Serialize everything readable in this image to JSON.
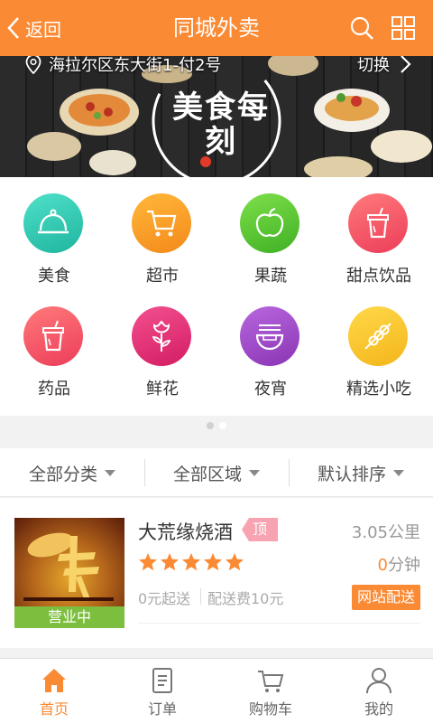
{
  "header": {
    "back_label": "返回",
    "title": "同城外卖"
  },
  "banner": {
    "address": "海拉尔区东大街1-付2号",
    "switch_label": "切换",
    "slogan": "美食每刻"
  },
  "categories": [
    {
      "label": "美食",
      "icon": "cloche-icon",
      "color": "#36c9b4"
    },
    {
      "label": "超市",
      "icon": "shopping-cart-icon",
      "color": "#f7a022"
    },
    {
      "label": "果蔬",
      "icon": "apple-icon",
      "color": "#5cc72e"
    },
    {
      "label": "甜点饮品",
      "icon": "drink-cup-icon",
      "color": "#f25a6a"
    },
    {
      "label": "药品",
      "icon": "medicine-icon",
      "color": "#f25a6a"
    },
    {
      "label": "鲜花",
      "icon": "rose-icon",
      "color": "#e7337a"
    },
    {
      "label": "夜宵",
      "icon": "noodle-bowl-icon",
      "color": "#9d48c2"
    },
    {
      "label": "精选小吃",
      "icon": "skewer-icon",
      "color": "#f7c82a"
    }
  ],
  "filters": [
    {
      "label": "全部分类"
    },
    {
      "label": "全部区域"
    },
    {
      "label": "默认排序"
    }
  ],
  "shop": {
    "name": "大荒缘烧酒",
    "tag": "顶",
    "distance": "3.05公里",
    "rating": 5,
    "time_value": "0",
    "time_unit": "分钟",
    "min_order": "0元起送",
    "delivery_fee": "配送费10元",
    "delivery_type": "网站配送",
    "status": "营业中"
  },
  "tabs": [
    {
      "label": "首页",
      "icon": "home-icon",
      "active": true
    },
    {
      "label": "订单",
      "icon": "order-icon",
      "active": false
    },
    {
      "label": "购物车",
      "icon": "cart-icon",
      "active": false
    },
    {
      "label": "我的",
      "icon": "user-icon",
      "active": false
    }
  ],
  "colors": {
    "accent": "#fb8a34",
    "open_status": "#7cbf3e",
    "top_tag": "#f8a3b1",
    "star": "#fb8a34"
  }
}
